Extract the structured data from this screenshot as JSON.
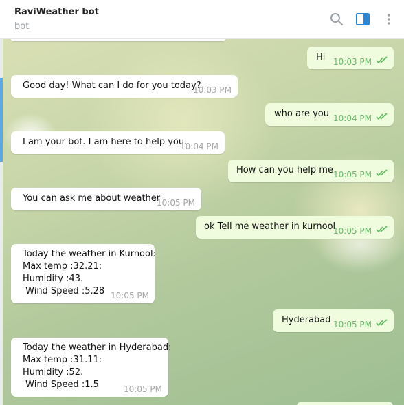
{
  "header": {
    "title": "RaviWeather bot",
    "subtitle": "bot",
    "icons": [
      "search-icon",
      "sidebar-toggle-icon",
      "more-vertical-icon"
    ],
    "accent_color": "#2a86d7"
  },
  "messages": [
    {
      "direction": "out",
      "text": "Hi",
      "time": "10:03 PM",
      "status": "read"
    },
    {
      "direction": "in",
      "text": "Good day! What can I do for you today?",
      "time": "10:03 PM"
    },
    {
      "direction": "out",
      "text": "who are you",
      "time": "10:04 PM",
      "status": "read"
    },
    {
      "direction": "in",
      "text": "I am your bot. I am here to help you.",
      "time": "10:04 PM"
    },
    {
      "direction": "out",
      "text": "How can you help me",
      "time": "10:05 PM",
      "status": "read"
    },
    {
      "direction": "in",
      "text": "You can ask me about weather",
      "time": "10:05 PM"
    },
    {
      "direction": "out",
      "text": "ok Tell me weather in kurnool",
      "time": "10:05 PM",
      "status": "read"
    },
    {
      "direction": "in",
      "text": "Today the weather in Kurnool:\nMax temp :32.21:\nHumidity :43.\n Wind Speed :5.28",
      "time": "10:05 PM"
    },
    {
      "direction": "out",
      "text": "Hyderabad",
      "time": "10:05 PM",
      "status": "read"
    },
    {
      "direction": "in",
      "text": "Today the weather in Hyderabad:\nMax temp :31.11:\nHumidity :52.\n Wind Speed :1.5",
      "time": "10:05 PM"
    }
  ]
}
